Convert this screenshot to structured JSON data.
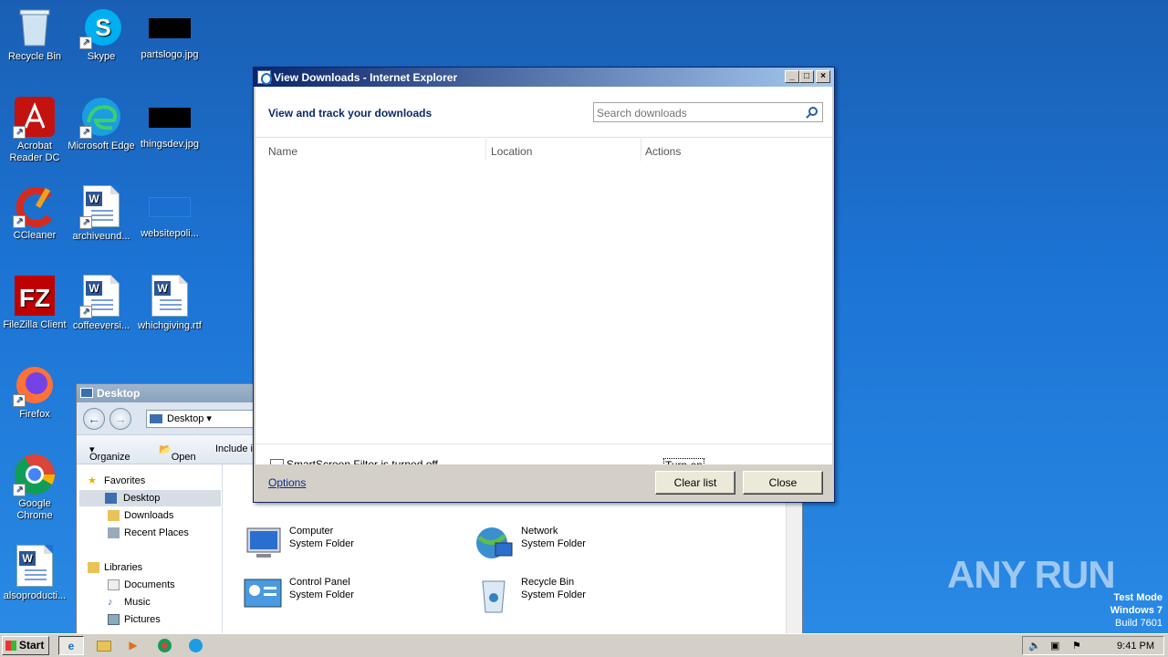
{
  "desktop": {
    "icons": [
      {
        "label": "Recycle Bin"
      },
      {
        "label": "Skype"
      },
      {
        "label": "partslogo.jpg"
      },
      {
        "label": "Acrobat Reader DC"
      },
      {
        "label": "Microsoft Edge"
      },
      {
        "label": "thingsdev.jpg"
      },
      {
        "label": "CCleaner"
      },
      {
        "label": "archiveund..."
      },
      {
        "label": "websitepoli..."
      },
      {
        "label": "FileZilla Client"
      },
      {
        "label": "coffeeversi..."
      },
      {
        "label": "whichgiving.rtf"
      },
      {
        "label": "Firefox"
      },
      {
        "label": "Google Chrome"
      },
      {
        "label": "alsoproducti..."
      }
    ]
  },
  "explorer": {
    "title": "Desktop",
    "address": "Desktop",
    "commands": {
      "organize": "Organize",
      "open": "Open",
      "include": "Include i"
    },
    "nav": {
      "favorites": "Favorites",
      "desktop": "Desktop",
      "downloads": "Downloads",
      "recent": "Recent Places",
      "libraries": "Libraries",
      "documents": "Documents",
      "music": "Music",
      "pictures": "Pictures"
    },
    "items": [
      {
        "name": "Computer",
        "type": "System Folder"
      },
      {
        "name": "Network",
        "type": "System Folder"
      },
      {
        "name": "Control Panel",
        "type": "System Folder"
      },
      {
        "name": "Recycle Bin",
        "type": "System Folder"
      }
    ]
  },
  "dialog": {
    "title": "View Downloads - Internet Explorer",
    "heading": "View and track your downloads",
    "search_placeholder": "Search downloads",
    "columns": {
      "name": "Name",
      "location": "Location",
      "actions": "Actions"
    },
    "smartscreen_text": "SmartScreen Filter is turned off.",
    "turn_on": "Turn on",
    "options": "Options",
    "clear_list": "Clear list",
    "close": "Close"
  },
  "taskbar": {
    "start": "Start",
    "clock": "9:41 PM"
  },
  "watermark": "ANY RUN",
  "test_mode": {
    "line1": "Test Mode",
    "line2": "Windows 7",
    "line3": "Build 7601"
  },
  "colors": {
    "desktop": "#1c73d3",
    "dialog_title_start": "#0a246a",
    "dialog_title_end": "#a6caf0",
    "link": "#0b2a90"
  }
}
